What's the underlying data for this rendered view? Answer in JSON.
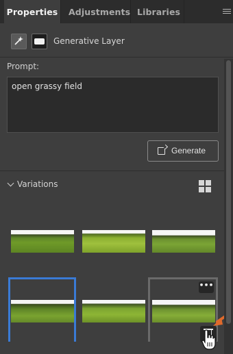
{
  "tabs": [
    {
      "label": "Properties",
      "active": true
    },
    {
      "label": "Adjustments",
      "active": false
    },
    {
      "label": "Libraries",
      "active": false
    }
  ],
  "panel_menu_icon": "hamburger-icon",
  "layer": {
    "type_icon": "generative-layer-icon",
    "mask_icon": "layer-mask-icon",
    "title": "Generative Layer"
  },
  "prompt": {
    "label": "Prompt:",
    "value": "open grassy field"
  },
  "generate_button": {
    "label": "Generate",
    "icon": "generate-icon"
  },
  "variations": {
    "label": "Variations",
    "view_icon": "grid-view-icon",
    "items": [
      {
        "id": "variation-1",
        "selected": false
      },
      {
        "id": "variation-2",
        "selected": false
      },
      {
        "id": "variation-3",
        "selected": false
      },
      {
        "id": "variation-4",
        "selected": true
      },
      {
        "id": "variation-5",
        "selected": false
      },
      {
        "id": "variation-6",
        "selected": false,
        "hovered": true
      }
    ],
    "more_options_label": "•••",
    "delete_icon": "trash-icon"
  },
  "colors": {
    "selection": "#3a7bd6",
    "annotation_arrow": "#e06a2c"
  }
}
